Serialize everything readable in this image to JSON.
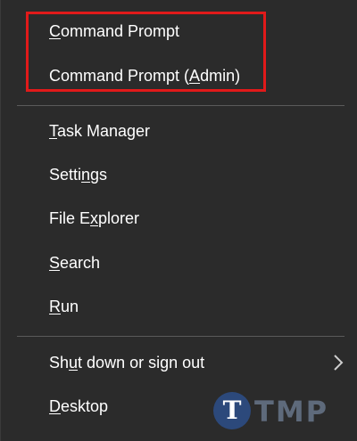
{
  "menu": {
    "items": [
      {
        "id": "command-prompt",
        "pre": "",
        "key": "C",
        "post": "ommand Prompt"
      },
      {
        "id": "command-prompt-admin",
        "pre": "Command Prompt (",
        "key": "A",
        "post": "dmin)"
      },
      {
        "id": "task-manager",
        "pre": "",
        "key": "T",
        "post": "ask Manager"
      },
      {
        "id": "settings",
        "pre": "Setti",
        "key": "n",
        "post": "gs"
      },
      {
        "id": "file-explorer",
        "pre": "File E",
        "key": "x",
        "post": "plorer"
      },
      {
        "id": "search",
        "pre": "",
        "key": "S",
        "post": "earch"
      },
      {
        "id": "run",
        "pre": "",
        "key": "R",
        "post": "un"
      },
      {
        "id": "shut-down",
        "pre": "Sh",
        "key": "u",
        "post": "t down or sign out"
      },
      {
        "id": "desktop",
        "pre": "",
        "key": "D",
        "post": "esktop"
      }
    ]
  },
  "icons": {
    "submenu": "chevron-right-icon"
  },
  "colors": {
    "background": "#2b2b2b",
    "text": "#ffffff",
    "separator": "#5a5a5a",
    "highlight": "#e11a1a",
    "watermark": "#2d4f8a"
  },
  "watermark": {
    "logo_letter": "T",
    "text": "TMP"
  }
}
